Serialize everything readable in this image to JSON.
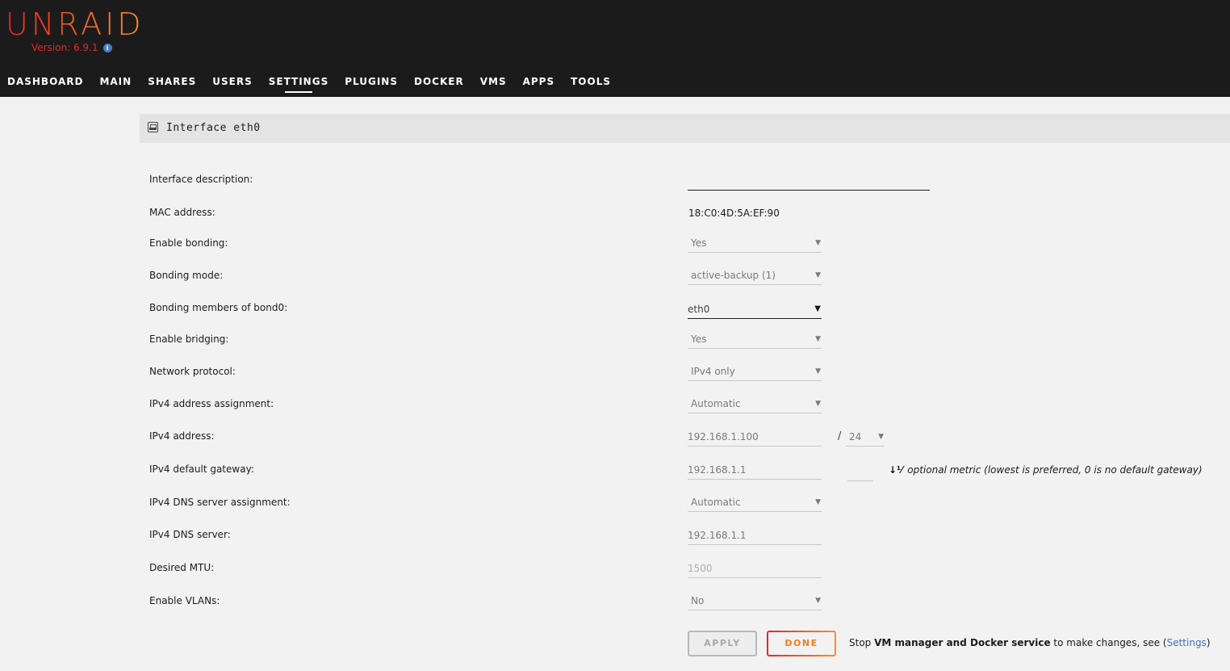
{
  "app": {
    "logo": "UNRAID",
    "version": "Version: 6.9.1",
    "info_icon": "i"
  },
  "nav": [
    "DASHBOARD",
    "MAIN",
    "SHARES",
    "USERS",
    "SETTINGS",
    "PLUGINS",
    "DOCKER",
    "VMS",
    "APPS",
    "TOOLS"
  ],
  "active_tab": "SETTINGS",
  "panel": {
    "title": "Interface eth0"
  },
  "form": {
    "interface_description": {
      "label": "Interface description:",
      "value": ""
    },
    "mac_address": {
      "label": "MAC address:",
      "value": "18:C0:4D:5A:EF:90"
    },
    "enable_bonding": {
      "label": "Enable bonding:",
      "value": "Yes"
    },
    "bonding_mode": {
      "label": "Bonding mode:",
      "value": "active-backup (1)"
    },
    "bonding_members": {
      "label": "Bonding members of bond0:",
      "value": "eth0"
    },
    "enable_bridging": {
      "label": "Enable bridging:",
      "value": "Yes"
    },
    "network_protocol": {
      "label": "Network protocol:",
      "value": "IPv4 only"
    },
    "ipv4_assignment": {
      "label": "IPv4 address assignment:",
      "value": "Automatic"
    },
    "ipv4_address": {
      "label": "IPv4 address:",
      "value": "192.168.1.100",
      "slash": "/",
      "prefix": "24"
    },
    "ipv4_gateway": {
      "label": "IPv4 default gateway:",
      "value": "192.168.1.1",
      "metric": "",
      "metric_icon": "↓⅟",
      "metric_note": "optional metric (lowest is preferred, 0 is no default gateway)"
    },
    "ipv4_dns_assignment": {
      "label": "IPv4 DNS server assignment:",
      "value": "Automatic"
    },
    "ipv4_dns_server": {
      "label": "IPv4 DNS server:",
      "value": "192.168.1.1"
    },
    "desired_mtu": {
      "label": "Desired MTU:",
      "value": "1500"
    },
    "enable_vlans": {
      "label": "Enable VLANs:",
      "value": "No"
    }
  },
  "buttons": {
    "apply": "APPLY",
    "done": "DONE"
  },
  "footer": {
    "prefix": "Stop ",
    "bold": "VM manager and Docker service",
    "middle": " to make changes, see (",
    "link": "Settings",
    "suffix": ")"
  },
  "colors": {
    "brand_red": "#e22828",
    "brand_orange": "#ff8c2f",
    "link": "#486dba",
    "header_bg": "#1c1b1b"
  }
}
